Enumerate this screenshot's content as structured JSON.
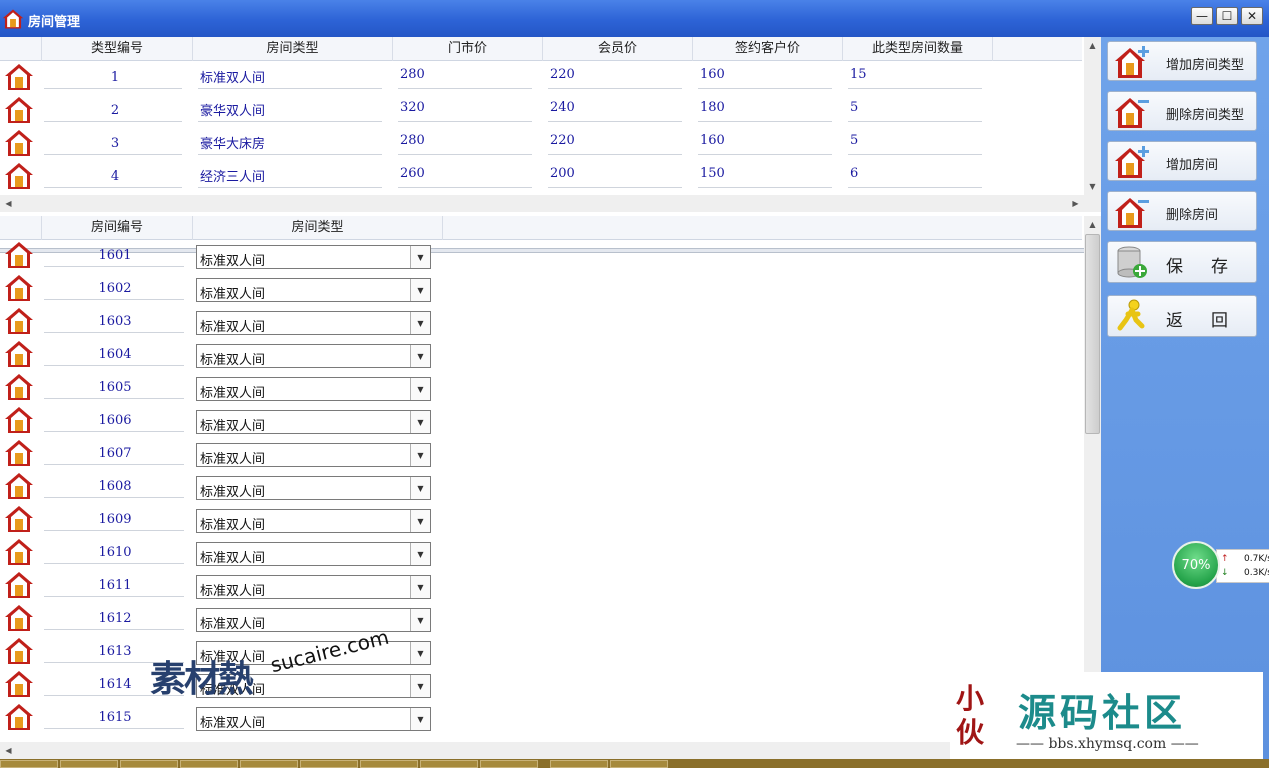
{
  "window": {
    "title": "房间管理",
    "controls": [
      "—",
      "☐",
      "✕"
    ]
  },
  "room_types": {
    "columns": [
      "类型编号",
      "房间类型",
      "门市价",
      "会员价",
      "签约客户价",
      "此类型房间数量"
    ],
    "rows": [
      {
        "id": "1",
        "type": "标准双人间",
        "rack": "280",
        "member": "220",
        "contract": "160",
        "count": "15"
      },
      {
        "id": "2",
        "type": "豪华双人间",
        "rack": "320",
        "member": "240",
        "contract": "180",
        "count": "5"
      },
      {
        "id": "3",
        "type": "豪华大床房",
        "rack": "280",
        "member": "220",
        "contract": "160",
        "count": "5"
      },
      {
        "id": "4",
        "type": "经济三人间",
        "rack": "260",
        "member": "200",
        "contract": "150",
        "count": "6"
      }
    ]
  },
  "rooms": {
    "columns": [
      "房间编号",
      "房间类型"
    ],
    "rows": [
      {
        "number": "1601",
        "type": "标准双人间"
      },
      {
        "number": "1602",
        "type": "标准双人间"
      },
      {
        "number": "1603",
        "type": "标准双人间"
      },
      {
        "number": "1604",
        "type": "标准双人间"
      },
      {
        "number": "1605",
        "type": "标准双人间"
      },
      {
        "number": "1606",
        "type": "标准双人间"
      },
      {
        "number": "1607",
        "type": "标准双人间"
      },
      {
        "number": "1608",
        "type": "标准双人间"
      },
      {
        "number": "1609",
        "type": "标准双人间"
      },
      {
        "number": "1610",
        "type": "标准双人间"
      },
      {
        "number": "1611",
        "type": "标准双人间"
      },
      {
        "number": "1612",
        "type": "标准双人间"
      },
      {
        "number": "1613",
        "type": "标准双人间"
      },
      {
        "number": "1614",
        "type": "标准双人间"
      },
      {
        "number": "1615",
        "type": "标准双人间"
      }
    ]
  },
  "sidebar": {
    "buttons": [
      {
        "label": "增加房间类型",
        "icon": "house-add-icon"
      },
      {
        "label": "删除房间类型",
        "icon": "house-remove-icon"
      },
      {
        "label": "增加房间",
        "icon": "house-add-icon"
      },
      {
        "label": "删除房间",
        "icon": "house-remove-icon"
      },
      {
        "label": "保存",
        "icon": "database-add-icon"
      },
      {
        "label": "返回",
        "icon": "running-person-icon"
      }
    ]
  },
  "net_widget": {
    "percent": "70%",
    "upload": "0.7K/s",
    "download": "0.3K/s"
  },
  "watermarks": {
    "left_main": "素材熱",
    "left_sub": "sucaire.com",
    "right_seal": "小伙",
    "right_main": "源码社区",
    "right_sub": "—— bbs.xhymsq.com ——"
  },
  "colors": {
    "title_bar": "#2d63d6",
    "sidebar": "#6fa3ea",
    "cell_text": "#1a1aa0",
    "house_roof": "#c0201a"
  }
}
